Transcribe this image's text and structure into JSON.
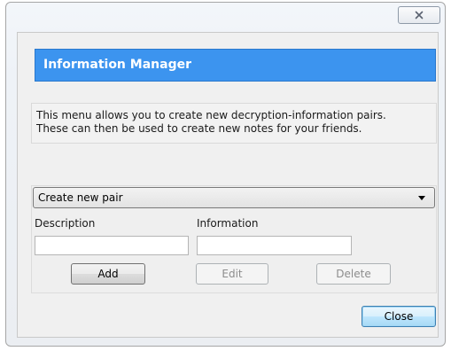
{
  "window": {
    "close_icon": "close-x-icon"
  },
  "header": {
    "title": "Information Manager"
  },
  "info": {
    "line1": "This menu allows you to create new decryption-information pairs.",
    "line2": "These can then be used to create new notes for your friends."
  },
  "pair_panel": {
    "selector_value": "Create new pair",
    "description_label": "Description",
    "description_value": "",
    "information_label": "Information",
    "information_value": "",
    "add_label": "Add",
    "edit_label": "Edit",
    "delete_label": "Delete"
  },
  "footer": {
    "close_label": "Close"
  },
  "colors": {
    "header_bg": "#3c94ef",
    "header_text": "#ffffff"
  }
}
